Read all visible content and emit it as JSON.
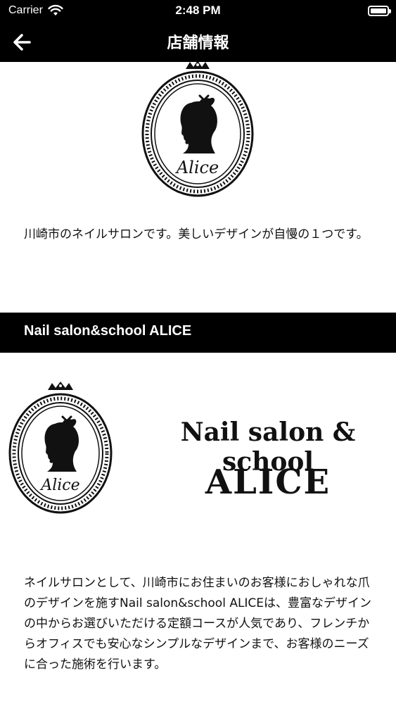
{
  "status_bar": {
    "carrier": "Carrier",
    "time": "2:48 PM"
  },
  "nav": {
    "title": "店舗情報",
    "back_icon": "arrow-left-icon"
  },
  "logo": {
    "script_text": "Alice"
  },
  "intro": {
    "text": "川崎市のネイルサロンです。美しいデザインが自慢の１つです。"
  },
  "section": {
    "title": "Nail salon&school ALICE"
  },
  "banner": {
    "line1": "Nail salon & school",
    "line2": "ALICE",
    "logo_script_text": "Alice"
  },
  "description": {
    "text": "ネイルサロンとして、川崎市にお住まいのお客様におしゃれな爪のデザインを施すNail salon&school ALICEは、豊富なデザインの中からお選びいただける定額コースが人気であり、フレンチからオフィスでも安心なシンプルなデザインまで、お客様のニーズに合った施術を行います。"
  },
  "colors": {
    "bar_background": "#000000",
    "bar_text": "#ffffff",
    "page_background": "#ffffff"
  }
}
